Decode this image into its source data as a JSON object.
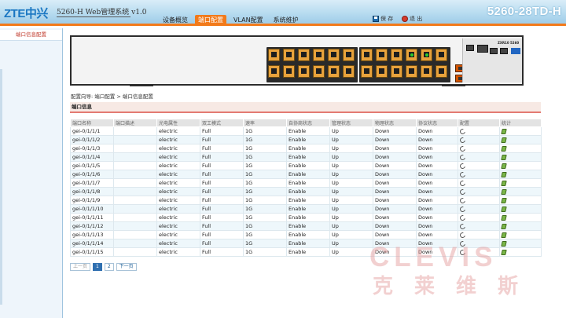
{
  "header": {
    "logo": "ZTE中兴",
    "system_name": "5260-H Web管理系统 v1.0",
    "model": "5260-28TD-H",
    "nav": [
      {
        "label": "设备概览",
        "active": false
      },
      {
        "label": "端口配置",
        "active": true
      },
      {
        "label": "VLAN配置",
        "active": false
      },
      {
        "label": "系统维护",
        "active": false
      }
    ],
    "save_label": "保 存",
    "exit_label": "退 出",
    "accent_color": "#f27a1a"
  },
  "sidebar": {
    "items": [
      {
        "label": "端口信息配置",
        "active": true
      }
    ]
  },
  "device": {
    "brand": "ZXR10 5260",
    "linked_ports": [
      19,
      21,
      27,
      28
    ]
  },
  "breadcrumb": "配置向导: 端口配置 > 端口信息配置",
  "section_title": "端口信息",
  "table": {
    "headers": [
      "端口名称",
      "端口描述",
      "光电属性",
      "双工模式",
      "速率",
      "自协商状态",
      "管理状态",
      "物理状态",
      "协议状态",
      "配置",
      "统计"
    ],
    "rows": [
      {
        "name": "gei-0/1/1/1",
        "desc": "",
        "medium": "electric",
        "duplex": "Full",
        "speed": "1G",
        "autoneg": "Enable",
        "admin": "Up",
        "phy": "Down",
        "proto": "Down"
      },
      {
        "name": "gei-0/1/1/2",
        "desc": "",
        "medium": "electric",
        "duplex": "Full",
        "speed": "1G",
        "autoneg": "Enable",
        "admin": "Up",
        "phy": "Down",
        "proto": "Down"
      },
      {
        "name": "gei-0/1/1/3",
        "desc": "",
        "medium": "electric",
        "duplex": "Full",
        "speed": "1G",
        "autoneg": "Enable",
        "admin": "Up",
        "phy": "Down",
        "proto": "Down"
      },
      {
        "name": "gei-0/1/1/4",
        "desc": "",
        "medium": "electric",
        "duplex": "Full",
        "speed": "1G",
        "autoneg": "Enable",
        "admin": "Up",
        "phy": "Down",
        "proto": "Down"
      },
      {
        "name": "gei-0/1/1/5",
        "desc": "",
        "medium": "electric",
        "duplex": "Full",
        "speed": "1G",
        "autoneg": "Enable",
        "admin": "Up",
        "phy": "Down",
        "proto": "Down"
      },
      {
        "name": "gei-0/1/1/6",
        "desc": "",
        "medium": "electric",
        "duplex": "Full",
        "speed": "1G",
        "autoneg": "Enable",
        "admin": "Up",
        "phy": "Down",
        "proto": "Down"
      },
      {
        "name": "gei-0/1/1/7",
        "desc": "",
        "medium": "electric",
        "duplex": "Full",
        "speed": "1G",
        "autoneg": "Enable",
        "admin": "Up",
        "phy": "Down",
        "proto": "Down"
      },
      {
        "name": "gei-0/1/1/8",
        "desc": "",
        "medium": "electric",
        "duplex": "Full",
        "speed": "1G",
        "autoneg": "Enable",
        "admin": "Up",
        "phy": "Down",
        "proto": "Down"
      },
      {
        "name": "gei-0/1/1/9",
        "desc": "",
        "medium": "electric",
        "duplex": "Full",
        "speed": "1G",
        "autoneg": "Enable",
        "admin": "Up",
        "phy": "Down",
        "proto": "Down"
      },
      {
        "name": "gei-0/1/1/10",
        "desc": "",
        "medium": "electric",
        "duplex": "Full",
        "speed": "1G",
        "autoneg": "Enable",
        "admin": "Up",
        "phy": "Down",
        "proto": "Down"
      },
      {
        "name": "gei-0/1/1/11",
        "desc": "",
        "medium": "electric",
        "duplex": "Full",
        "speed": "1G",
        "autoneg": "Enable",
        "admin": "Up",
        "phy": "Down",
        "proto": "Down"
      },
      {
        "name": "gei-0/1/1/12",
        "desc": "",
        "medium": "electric",
        "duplex": "Full",
        "speed": "1G",
        "autoneg": "Enable",
        "admin": "Up",
        "phy": "Down",
        "proto": "Down"
      },
      {
        "name": "gei-0/1/1/13",
        "desc": "",
        "medium": "electric",
        "duplex": "Full",
        "speed": "1G",
        "autoneg": "Enable",
        "admin": "Up",
        "phy": "Down",
        "proto": "Down"
      },
      {
        "name": "gei-0/1/1/14",
        "desc": "",
        "medium": "electric",
        "duplex": "Full",
        "speed": "1G",
        "autoneg": "Enable",
        "admin": "Up",
        "phy": "Down",
        "proto": "Down"
      },
      {
        "name": "gei-0/1/1/15",
        "desc": "",
        "medium": "electric",
        "duplex": "Full",
        "speed": "1G",
        "autoneg": "Enable",
        "admin": "Up",
        "phy": "Down",
        "proto": "Down"
      }
    ],
    "config_icon": "wrench-icon",
    "stats_icon": "chart-icon"
  },
  "pager": {
    "prev": "上一页",
    "pages": [
      "1",
      "2"
    ],
    "current": "1",
    "next": "下一页"
  },
  "watermark": {
    "en": "CLEVIS",
    "cn": "克莱维斯"
  }
}
